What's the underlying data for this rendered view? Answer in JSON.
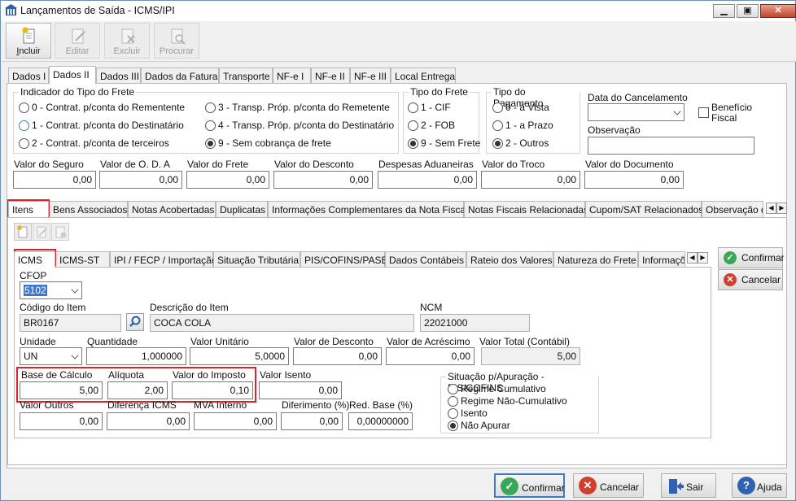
{
  "window": {
    "title": "Lançamentos de Saída - ICMS/IPI"
  },
  "toolbar": {
    "incluir": "Incluir",
    "incluir_key": "I",
    "incluir_rest": "ncluir",
    "editar": "Editar",
    "excluir": "Excluir",
    "procurar": "Procurar"
  },
  "top_tabs": [
    "Dados I",
    "Dados II",
    "Dados III",
    "Dados da Fatura",
    "Transporte",
    "NF-e I",
    "NF-e II",
    "NF-e III",
    "Local Entrega"
  ],
  "frete": {
    "title": "Indicador do Tipo do Frete",
    "options": [
      "0 - Contrat. p/conta do Rementente",
      "1 - Contrat. p/conta do Destinatário",
      "2 - Contrat. p/conta de terceiros",
      "3 - Transp. Próp. p/conta do Remetente",
      "4 - Transp. Próp. p/conta do Destinatário",
      "9 - Sem cobrança de frete"
    ]
  },
  "tipo_frete": {
    "title": "Tipo do Frete",
    "options": [
      "1 - CIF",
      "2 - FOB",
      "9 - Sem Frete"
    ]
  },
  "tipo_pagamento": {
    "title": "Tipo do Pagamento",
    "options": [
      "0 - à Vista",
      "1 - a Prazo",
      "2 - Outros"
    ]
  },
  "cancelamento": {
    "label": "Data do Cancelamento",
    "value": ""
  },
  "beneficio": {
    "label_line1": "Benefício",
    "label_line2": "Fiscal"
  },
  "observacao": {
    "label": "Observação",
    "value": ""
  },
  "valores": [
    {
      "label": "Valor do Seguro",
      "value": "0,00"
    },
    {
      "label": "Valor de O. D. A",
      "value": "0,00"
    },
    {
      "label": "Valor do Frete",
      "value": "0,00"
    },
    {
      "label": "Valor do Desconto",
      "value": "0,00"
    },
    {
      "label": "Despesas Aduaneiras",
      "value": "0,00"
    },
    {
      "label": "Valor do Troco",
      "value": "0,00"
    },
    {
      "label": "Valor do Documento",
      "value": "0,00"
    }
  ],
  "mid_tabs": [
    "Itens",
    "Bens Associados",
    "Notas Acobertadas",
    "Duplicatas",
    "Informações Complementares da Nota Fiscal",
    "Notas Fiscais Relacionadas",
    "Cupom/SAT Relacionados",
    "Observação d"
  ],
  "item_tabs": [
    "ICMS",
    "ICMS-ST",
    "IPI / FECP / Importação",
    "Situação Tributária",
    "PIS/COFINS/PASEP",
    "Dados Contábeis",
    "Rateio dos Valores",
    "Natureza do Frete",
    "Informações"
  ],
  "item": {
    "cfop_label": "CFOP",
    "cfop": "5102",
    "codigo_label": "Código do Item",
    "codigo": "BR0167",
    "descricao_label": "Descrição do Item",
    "descricao": "COCA COLA",
    "ncm_label": "NCM",
    "ncm": "22021000",
    "unidade_label": "Unidade",
    "unidade": "UN",
    "quantidade_label": "Quantidade",
    "quantidade": "1,000000",
    "valor_unitario_label": "Valor Unitário",
    "valor_unitario": "5,0000",
    "valor_desconto_label": "Valor de Desconto",
    "valor_desconto": "0,00",
    "valor_acrescimo_label": "Valor de Acréscimo",
    "valor_acrescimo": "0,00",
    "valor_total_label": "Valor Total (Contábil)",
    "valor_total": "5,00",
    "base_calculo_label": "Base de Cálculo",
    "base_calculo": "5,00",
    "aliquota_label": "Alíquota",
    "aliquota": "2,00",
    "valor_imposto_label": "Valor do Imposto",
    "valor_imposto": "0,10",
    "valor_isento_label": "Valor Isento",
    "valor_isento": "0,00",
    "valor_outros_label": "Valor Outros",
    "valor_outros": "0,00",
    "diferenca_label": "Diferença ICMS",
    "diferenca": "0,00",
    "mva_label": "MVA Interno",
    "mva": "0,00",
    "diferimento_label": "Diferimento (%)",
    "diferimento": "0,00",
    "red_base_label": "Red. Base (%)",
    "red_base": "0,00000000"
  },
  "apuracao": {
    "title": "Situação p/Apuração - PIS/COFINS",
    "options": [
      "Regime Cumulativo",
      "Regime Não-Cumulativo",
      "Isento",
      "Não Apurar"
    ]
  },
  "side_buttons": {
    "confirmar": "Confirmar",
    "cancelar": "Cancelar"
  },
  "bottom_buttons": {
    "confirmar": "Confirmar",
    "cancelar": "Cancelar",
    "sair": "Sair",
    "ajuda": "Ajuda"
  },
  "colors": {
    "red_highlight": "#d9242e",
    "confirm_green": "#3aa757",
    "cancel_red": "#d0402f",
    "help_blue": "#2f62b3"
  }
}
